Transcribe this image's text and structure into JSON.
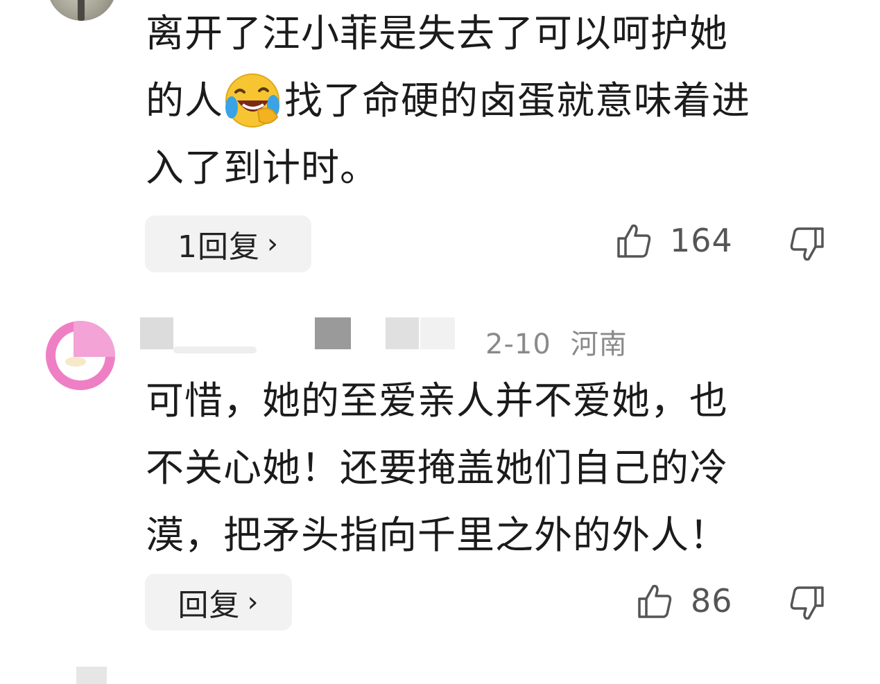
{
  "comment_1": {
    "lines": [
      "离开了汪小菲是失去了可以呵护她",
      "的人",
      "找了命硬的卤蛋就意味着进",
      "入了到计时。"
    ],
    "emoji": "laughing-crying-emoji",
    "reply_label": "1回复",
    "likes": "164"
  },
  "comment_2": {
    "date": "2-10",
    "location": "河南",
    "lines": [
      "可惜，她的至爱亲人并不爱她，也",
      "不关心她！还要掩盖她们自己的冷",
      "漠，把矛头指向千里之外的外人！"
    ],
    "reply_label": "回复",
    "likes": "86"
  },
  "icons": {
    "like": "thumbs-up-icon",
    "dislike": "thumbs-down-icon",
    "chevron": "chevron-right-icon"
  },
  "colors": {
    "pill_bg": "#f2f2f2",
    "meta_text": "#8a8a8a",
    "avatar_pink": "#ef7fc4"
  }
}
